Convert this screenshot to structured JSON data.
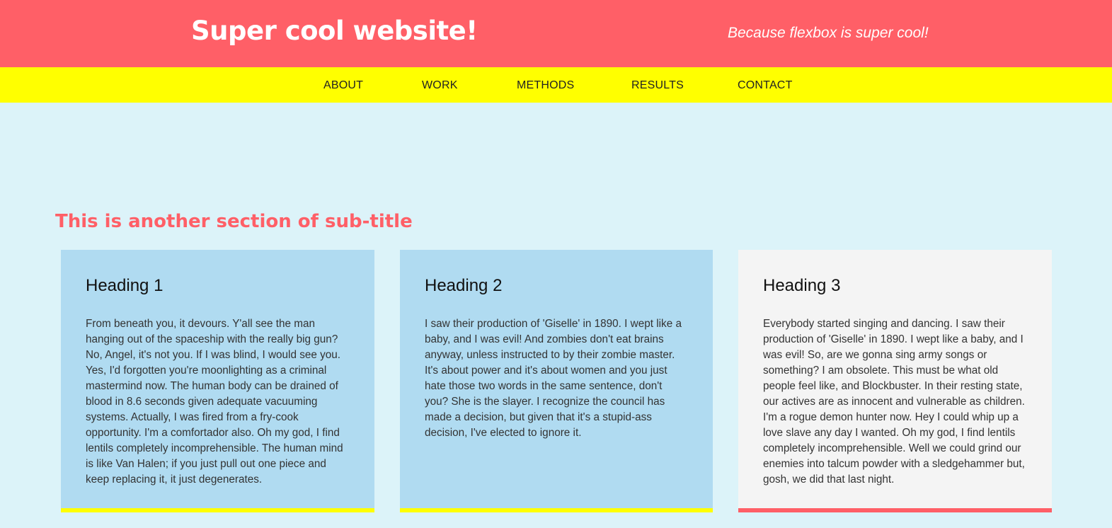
{
  "header": {
    "title": "Super cool website!",
    "tagline": "Because flexbox is super cool!"
  },
  "nav": {
    "items": [
      {
        "label": "ABOUT"
      },
      {
        "label": "WORK"
      },
      {
        "label": "METHODS"
      },
      {
        "label": "RESULTS"
      },
      {
        "label": "CONTACT"
      }
    ]
  },
  "section": {
    "title": "This is another section of sub-title"
  },
  "cards": [
    {
      "heading": "Heading 1",
      "text": "From beneath you, it devours. Y'all see the man hanging out of the spaceship with the really big gun? No, Angel, it's not you. If I was blind, I would see you. Yes, I'd forgotten you're moonlighting as a criminal mastermind now. The human body can be drained of blood in 8.6 seconds given adequate vacuuming systems. Actually, I was fired from a fry-cook opportunity. I'm a comfortador also. Oh my god, I find lentils completely incomprehensible. The human mind is like Van Halen; if you just pull out one piece and keep replacing it, it just degenerates."
    },
    {
      "heading": "Heading 2",
      "text": "I saw their production of 'Giselle' in 1890. I wept like a baby, and I was evil! And zombies don't eat brains anyway, unless instructed to by their zombie master. It's about power and it's about women and you just hate those two words in the same sentence, don't you? She is the slayer. I recognize the council has made a decision, but given that it's a stupid-ass decision, I've elected to ignore it."
    },
    {
      "heading": "Heading 3",
      "text": "Everybody started singing and dancing. I saw their production of 'Giselle' in 1890. I wept like a baby, and I was evil! So, are we gonna sing army songs or something? I am obsolete. This must be what old people feel like, and Blockbuster. In their resting state, our actives are as innocent and vulnerable as children. I'm a rogue demon hunter now. Hey I could whip up a love slave any day I wanted. Oh my god, I find lentils completely incomprehensible. Well we could grind our enemies into talcum powder with a sledgehammer but, gosh, we did that last night."
    }
  ],
  "colors": {
    "header_bg": "#ff5f67",
    "nav_bg": "#ffff00",
    "page_bg": "#dcf3f9",
    "card_blue": "#b0dbf1",
    "card_gray": "#f4f4f4",
    "accent_yellow": "#ffff00",
    "accent_red": "#ff5f67"
  }
}
